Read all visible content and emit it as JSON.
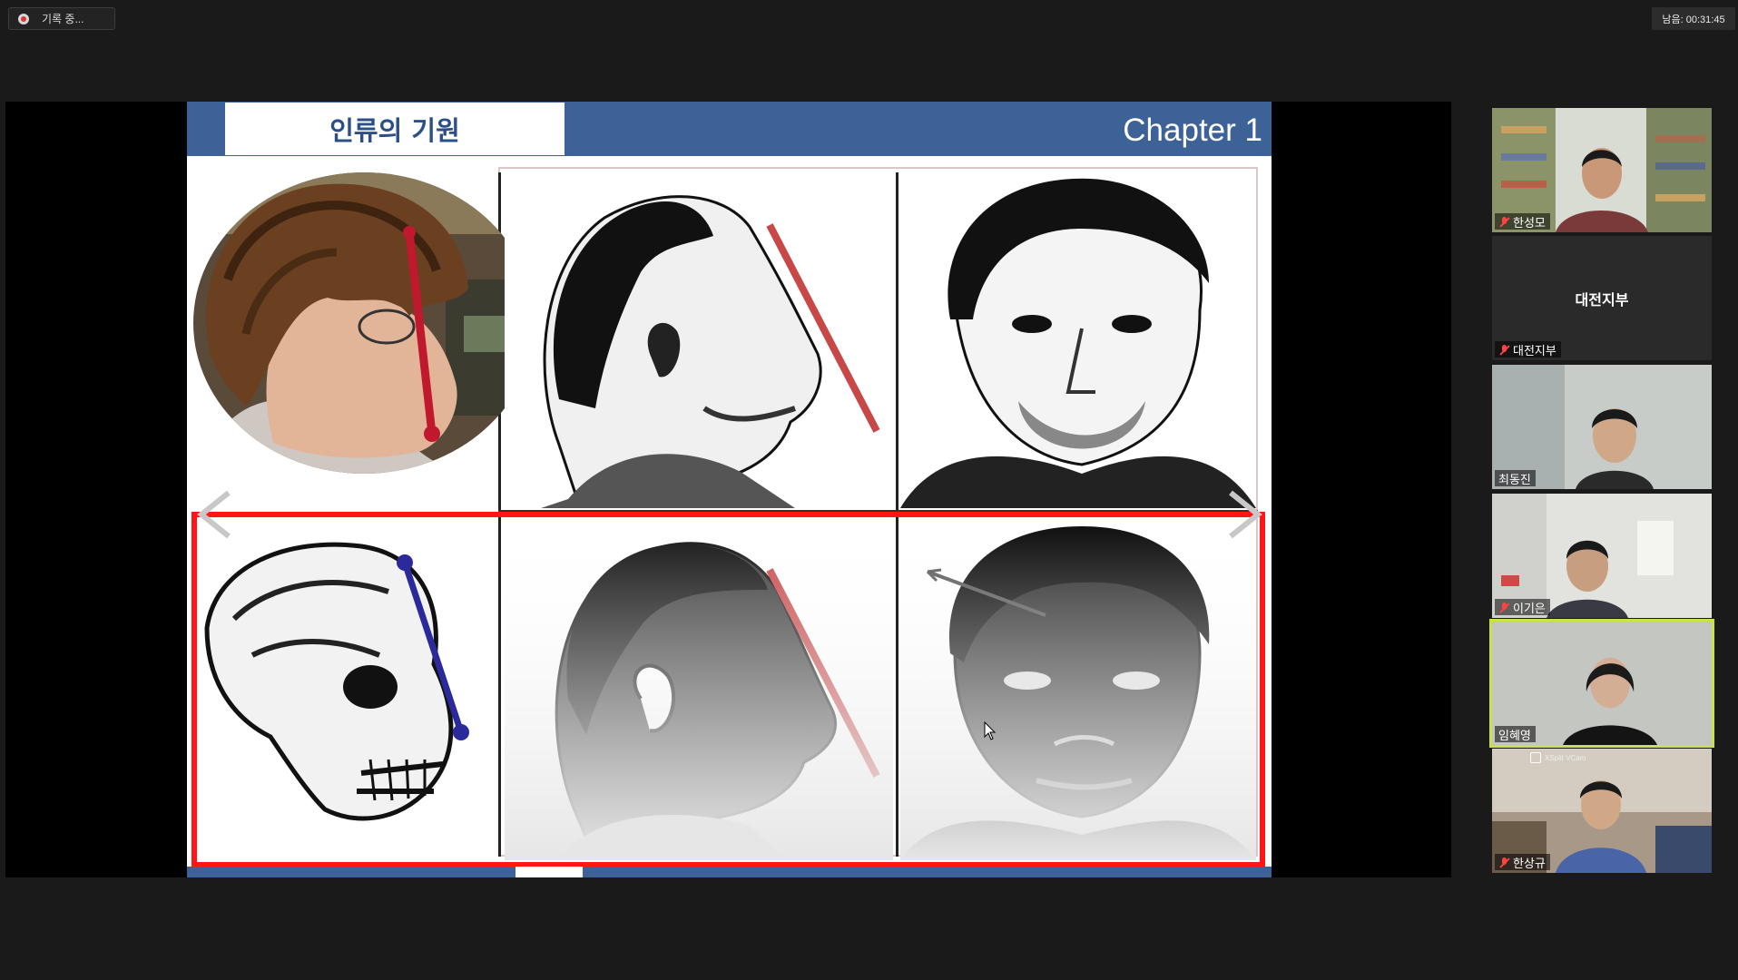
{
  "recording": {
    "label": "기록 중..."
  },
  "timer": {
    "text": "남음: 00:31:45"
  },
  "slide": {
    "title": "인류의 기원",
    "chapter": "Chapter 1"
  },
  "participants": [
    {
      "name": "한성모",
      "muted": true,
      "video": true
    },
    {
      "name": "대전지부",
      "muted": true,
      "video": false,
      "center_label": "대전지부"
    },
    {
      "name": "최동진",
      "muted": false,
      "video": true
    },
    {
      "name": "이기은",
      "muted": true,
      "video": true
    },
    {
      "name": "임혜영",
      "muted": false,
      "video": true,
      "active": true
    },
    {
      "name": "한상규",
      "muted": true,
      "video": true,
      "vcam_label": "XSplit VCam"
    }
  ],
  "colors": {
    "header_blue": "#3c6298",
    "highlight_red": "#ff1616",
    "active_speaker": "#c8e24c"
  }
}
